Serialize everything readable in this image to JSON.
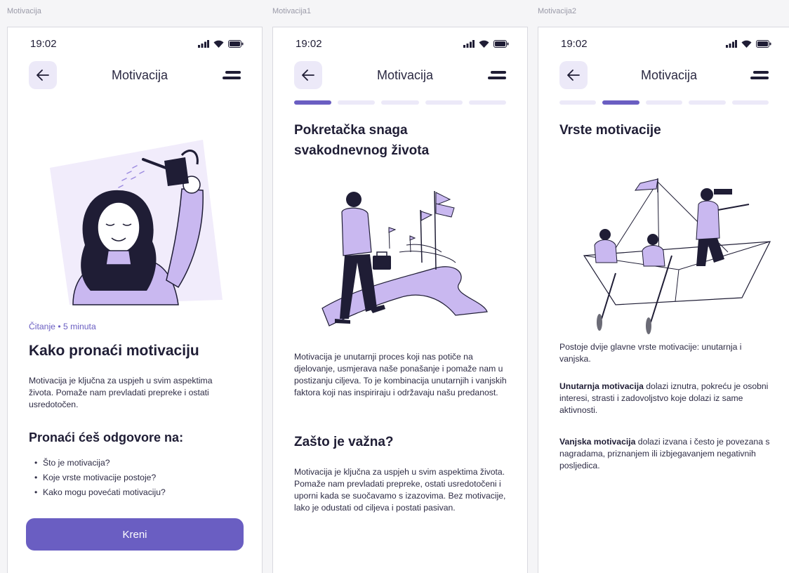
{
  "frames": [
    {
      "label": "Motivacija",
      "time": "19:02",
      "header_title": "Motivacija",
      "meta": "Čitanje • 5 minuta",
      "title": "Kako pronaći motivaciju",
      "intro": "Motivacija je ključna za uspjeh u svim aspektima života. Pomaže nam prevladati prepreke i ostati usredotočen.",
      "subtitle": "Pronaći ćeš odgovore na:",
      "bullets": [
        "Što je motivacija?",
        "Koje vrste motivacije postoje?",
        "Kako mogu povećati motivaciju?"
      ],
      "button": "Kreni"
    },
    {
      "label": "Motivacija1",
      "time": "19:02",
      "header_title": "Motivacija",
      "progress_step": 1,
      "progress_total": 5,
      "title_line1": "Pokretačka snaga",
      "title_line2": "svakodnevnog života",
      "paragraph1": "Motivacija je unutarnji proces koji nas potiče na djelovanje, usmjerava naše ponašanje i pomaže nam u postizanju ciljeva. To je kombinacija unutarnjih i vanjskih faktora koji nas inspiriraju i održavaju našu predanost.",
      "subtitle": "Zašto je važna?",
      "paragraph2": "Motivacija je ključna za uspjeh u svim aspektima života. Pomaže nam prevladati prepreke, ostati usredotočeni i uporni kada se suočavamo s izazovima. Bez motivacije, lako je odustati od ciljeva i postati pasivan."
    },
    {
      "label": "Motivacija2",
      "time": "19:02",
      "header_title": "Motivacija",
      "progress_step": 2,
      "progress_total": 5,
      "title": "Vrste motivacije",
      "paragraph1": "Postoje dvije glavne vrste motivacije: unutarnja i vanjska.",
      "p2_bold": "Unutarnja motivacija",
      "p2_rest": " dolazi iznutra, pokreću je osobni interesi, strasti i zadovoljstvo koje dolazi iz same aktivnosti.",
      "p3_bold": "Vanjska motivacija",
      "p3_rest": " dolazi izvana i često je povezana s nagradama, priznanjem ili izbjegavanjem negativnih posljedica."
    }
  ],
  "colors": {
    "accent": "#6a5ec2",
    "accent_light": "#ece9f8",
    "illustration_lilac": "#c9b8f0",
    "text_dark": "#1f1d35"
  },
  "icons": [
    "signal-icon",
    "wifi-icon",
    "battery-icon",
    "back-arrow-icon",
    "menu-icon"
  ]
}
